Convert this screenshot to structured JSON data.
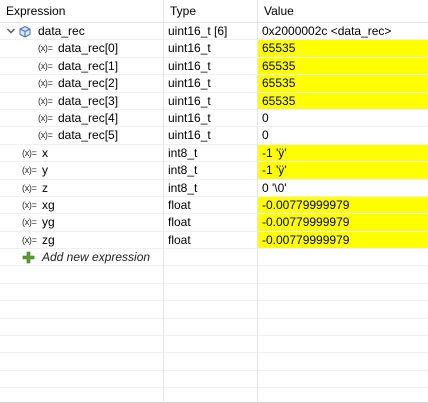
{
  "columns": {
    "expression": "Expression",
    "type": "Type",
    "value": "Value"
  },
  "var_icon_glyph": "(x)=",
  "rows": [
    {
      "name": "data_rec",
      "type": "uint16_t [6]",
      "value": "0x2000002c <data_rec>",
      "highlight": false,
      "level": 0,
      "kind": "struct"
    },
    {
      "name": "data_rec[0]",
      "type": "uint16_t",
      "value": "65535",
      "highlight": true,
      "level": 1,
      "kind": "var"
    },
    {
      "name": "data_rec[1]",
      "type": "uint16_t",
      "value": "65535",
      "highlight": true,
      "level": 1,
      "kind": "var"
    },
    {
      "name": "data_rec[2]",
      "type": "uint16_t",
      "value": "65535",
      "highlight": true,
      "level": 1,
      "kind": "var"
    },
    {
      "name": "data_rec[3]",
      "type": "uint16_t",
      "value": "65535",
      "highlight": true,
      "level": 1,
      "kind": "var"
    },
    {
      "name": "data_rec[4]",
      "type": "uint16_t",
      "value": "0",
      "highlight": false,
      "level": 1,
      "kind": "var"
    },
    {
      "name": "data_rec[5]",
      "type": "uint16_t",
      "value": "0",
      "highlight": false,
      "level": 1,
      "kind": "var"
    },
    {
      "name": "x",
      "type": "int8_t",
      "value": "-1 'ÿ'",
      "highlight": true,
      "level": 0,
      "kind": "var"
    },
    {
      "name": "y",
      "type": "int8_t",
      "value": "-1 'ÿ'",
      "highlight": true,
      "level": 0,
      "kind": "var"
    },
    {
      "name": "z",
      "type": "int8_t",
      "value": "0 '\\0'",
      "highlight": false,
      "level": 0,
      "kind": "var"
    },
    {
      "name": "xg",
      "type": "float",
      "value": "-0.00779999979",
      "highlight": true,
      "level": 0,
      "kind": "var"
    },
    {
      "name": "yg",
      "type": "float",
      "value": "-0.00779999979",
      "highlight": true,
      "level": 0,
      "kind": "var"
    },
    {
      "name": "zg",
      "type": "float",
      "value": "-0.00779999979",
      "highlight": true,
      "level": 0,
      "kind": "var"
    }
  ],
  "add_expression": {
    "label": "Add new expression",
    "icon": "plus-icon"
  },
  "empty_rows": 7,
  "colors": {
    "highlight": "#ffff00",
    "add_icon": "#5aa02c",
    "struct_icon": "#3f6fb5"
  }
}
